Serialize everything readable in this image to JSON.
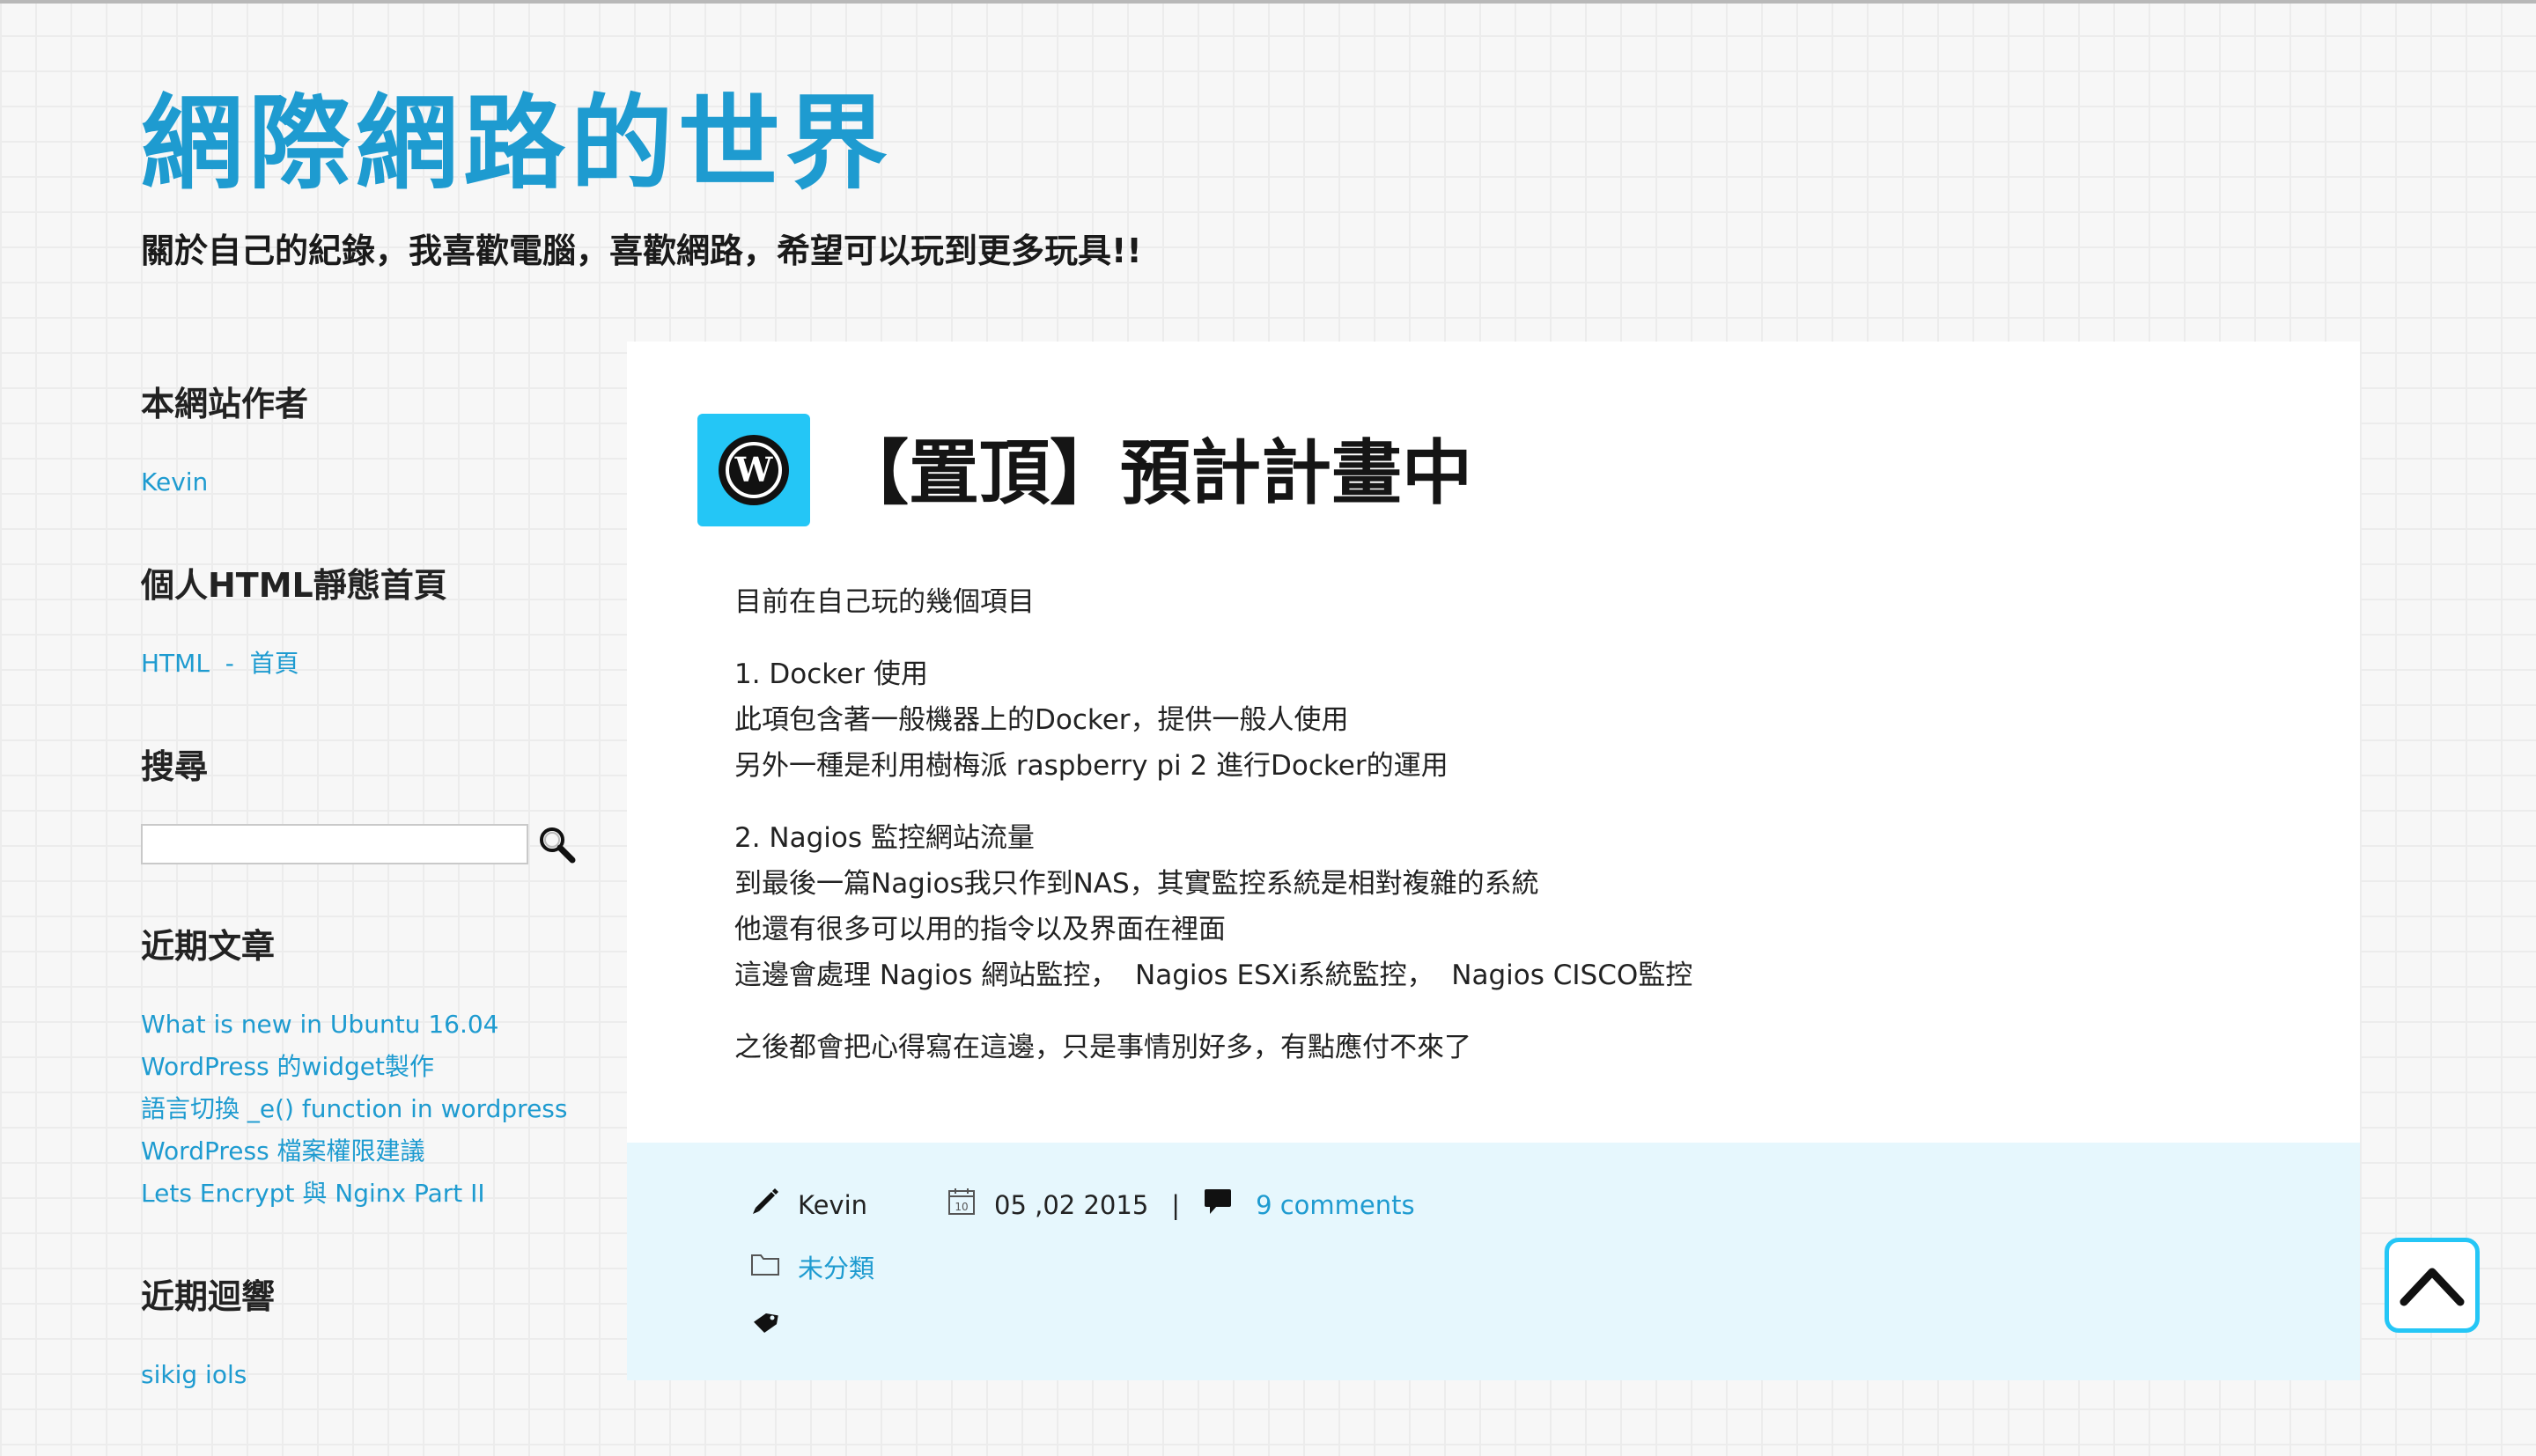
{
  "site": {
    "title": "網際網路的世界",
    "description": "關於自己的紀錄，我喜歡電腦，喜歡網路，希望可以玩到更多玩具!!"
  },
  "sidebar": {
    "author": {
      "title": "本網站作者",
      "link": "Kevin"
    },
    "homepage": {
      "title": "個人HTML靜態首頁",
      "link": "HTML  -  首頁"
    },
    "search": {
      "title": "搜尋",
      "placeholder": "",
      "icon": "search-icon"
    },
    "recent_posts": {
      "title": "近期文章",
      "items": [
        "What is new in Ubuntu 16.04",
        "WordPress 的widget製作",
        "語言切換 _e() function in wordpress",
        "WordPress 檔案權限建議",
        "Lets Encrypt 與 Nginx Part II"
      ]
    },
    "recent_comments": {
      "title": "近期迴響",
      "first": "sikig iols"
    }
  },
  "post": {
    "icon": "wordpress-icon",
    "title": "【置頂】預計計畫中",
    "intro": "目前在自己玩的幾個項目",
    "sections": [
      {
        "lines": [
          "1. Docker 使用",
          "此項包含著一般機器上的Docker，提供一般人使用",
          "另外一種是利用樹梅派 raspberry pi 2 進行Docker的運用"
        ]
      },
      {
        "lines": [
          "2. Nagios 監控網站流量",
          "到最後一篇Nagios我只作到NAS，其實監控系統是相對複雜的系統",
          "他還有很多可以用的指令以及界面在裡面",
          "這邊會處理 Nagios 網站監控，  Nagios ESXi系統監控，  Nagios CISCO監控"
        ]
      }
    ],
    "outro": "之後都會把心得寫在這邊，只是事情別好多，有點應付不來了",
    "meta": {
      "author": "Kevin",
      "date": "05 ,02 2015",
      "separator": "|",
      "comments": "9 comments",
      "category": "未分類",
      "calendar_day": "10"
    }
  },
  "colors": {
    "accent": "#1e9bd0",
    "icon_bg": "#24c6f6",
    "footer_bg": "#e6f7fd"
  }
}
